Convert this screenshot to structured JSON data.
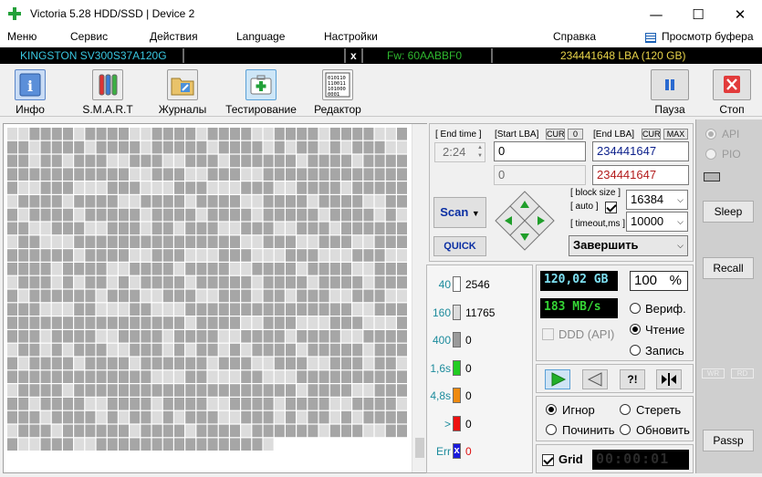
{
  "window": {
    "title": "Victoria 5.28 HDD/SSD | Device 2",
    "minimize": "—",
    "maximize": "☐",
    "close": "✕"
  },
  "menu": {
    "items": [
      "Меню",
      "Сервис",
      "Действия",
      "Language",
      "Настройки"
    ],
    "help": "Справка",
    "buffer": "Просмотр буфера"
  },
  "drive": {
    "model": "KINGSTON SV300S37A120G",
    "close_mark": "x",
    "firmware": "Fw: 60AABBF0",
    "capacity": "234441648 LBA (120 GB)",
    "colors": {
      "model": "#39c7e0",
      "firmware": "#2fb82f",
      "capacity": "#e8d44a"
    }
  },
  "toolbar": {
    "info": "Инфо",
    "smart": "S.M.A.R.T",
    "logs": "Журналы",
    "testing": "Тестирование",
    "editor": "Редактор",
    "editor_icon_text": "010110\n110011\n101000\n0001",
    "pause": "Пауза",
    "stop": "Стоп"
  },
  "scan": {
    "end_time_label": "[ End time ]",
    "end_time_value": "2:24",
    "start_lba_label": "[Start LBA]",
    "cur_tag": "CUR",
    "zero_tag": "0",
    "start_lba_value": "0",
    "start_lba_cur": "0",
    "end_lba_label": "[End LBA]",
    "cur_tag2": "CUR",
    "max_tag": "MAX",
    "end_lba_value": "234441647",
    "end_lba_cur": "234441647",
    "scan_button": "Scan",
    "quick_button": "QUICK",
    "block_size_label": "[ block size ]",
    "auto_label": "[ auto ]",
    "block_size_value": "16384",
    "timeout_label": "[ timeout,ms ]",
    "timeout_value": "10000",
    "finish_value": "Завершить"
  },
  "legend": [
    {
      "label": "40",
      "value": "2546",
      "color": "#ffffff"
    },
    {
      "label": "160",
      "value": "11765",
      "color": "#dcdcdc"
    },
    {
      "label": "400",
      "value": "0",
      "color": "#9a9a9a"
    },
    {
      "label": "1,6s",
      "value": "0",
      "color": "#22cc22"
    },
    {
      "label": "4,8s",
      "value": "0",
      "color": "#ee8a10"
    },
    {
      "label": ">",
      "value": "0",
      "color": "#ee1111"
    },
    {
      "label": "Err",
      "value": "0",
      "color": "#1a1adc",
      "mark": "x"
    }
  ],
  "stats": {
    "size": "120,02 GB",
    "percent": "100",
    "percent_sign": "%",
    "speed": "183 MB/s",
    "ddd_label": "DDD (API)",
    "mode_verify": "Вериф.",
    "mode_read": "Чтение",
    "mode_write": "Запись"
  },
  "actions": {
    "ignore": "Игнор",
    "erase": "Стереть",
    "repair": "Починить",
    "refresh": "Обновить",
    "grid_label": "Grid",
    "timer": "00:00:01",
    "seek_label": "?",
    "random_label": "?!"
  },
  "right": {
    "api": "API",
    "pio": "PIO",
    "sleep": "Sleep",
    "recall": "Recall",
    "wr": "WR",
    "rd": "RD",
    "passp": "Passp"
  },
  "map": {
    "cell_color": "#a6a6a6",
    "light_color": "#dcdcdc"
  }
}
